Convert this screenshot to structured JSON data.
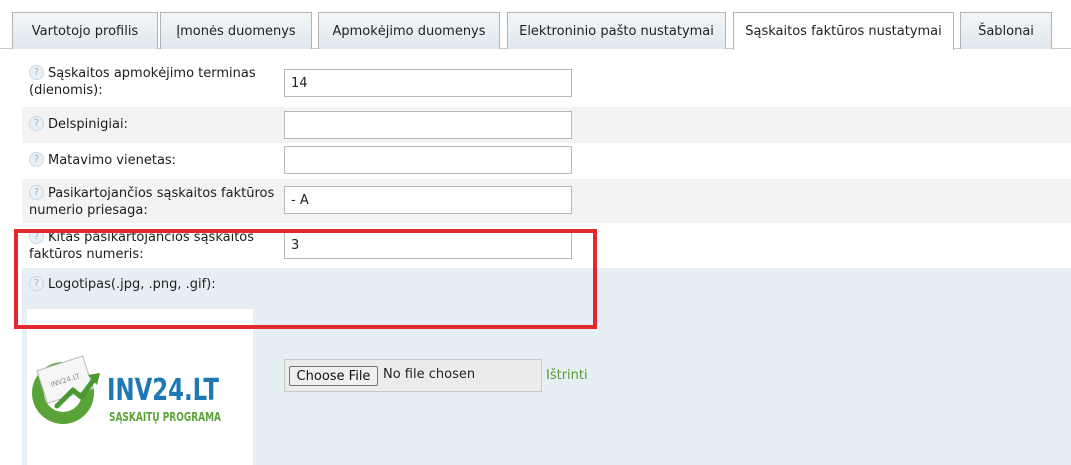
{
  "tabs": [
    {
      "label": "Vartotojo profilis",
      "active": false
    },
    {
      "label": "Įmonės duomenys",
      "active": false
    },
    {
      "label": "Apmokėjimo duomenys",
      "active": false
    },
    {
      "label": "Elektroninio pašto nustatymai",
      "active": false
    },
    {
      "label": "Sąskaitos faktūros nustatymai",
      "active": true
    },
    {
      "label": "Šablonai",
      "active": false
    }
  ],
  "help_icon_glyph": "?",
  "form": {
    "payment_term": {
      "label": "Sąskaitos apmokėjimo terminas (dienomis):",
      "value": "14"
    },
    "late_fee": {
      "label": "Delspinigiai:",
      "value": ""
    },
    "unit": {
      "label": "Matavimo vienetas:",
      "value": ""
    },
    "recurring_suffix": {
      "label": "Pasikartojančios sąskaitos faktūros numerio priesaga:",
      "value": "- A"
    },
    "next_recurring_number": {
      "label": "Kitas pasikartojančios sąskaitos faktūros numeris:",
      "value": "3"
    },
    "logo": {
      "label": "Logotipas(.jpg, .png, .gif):",
      "choose_file_label": "Choose File",
      "no_file_text": "No file chosen",
      "delete_label": "Ištrinti",
      "logo_text_main": "INV24.LT",
      "logo_text_sub": "SĄSKAITŲ PROGRAMA",
      "logo_doc_text": "INV24.LT"
    }
  },
  "colors": {
    "highlight": "#e3282f",
    "link": "#5b9b2e",
    "logo_blue": "#1e78b4",
    "logo_green": "#5aa339"
  }
}
